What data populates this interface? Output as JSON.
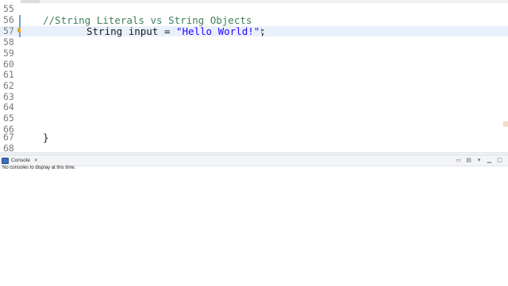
{
  "editor": {
    "lines": [
      {
        "num": "55",
        "code": ""
      },
      {
        "num": "56",
        "code": "//String Literals vs String Objects"
      },
      {
        "num": "57",
        "code_type": "String",
        "code_var": "input",
        "code_eq": "=",
        "code_str": "\"Hello World!\"",
        "code_end": ";"
      },
      {
        "num": "58",
        "code": ""
      },
      {
        "num": "59",
        "code": ""
      },
      {
        "num": "60",
        "code": ""
      },
      {
        "num": "61",
        "code": ""
      },
      {
        "num": "62",
        "code": ""
      },
      {
        "num": "63",
        "code": ""
      },
      {
        "num": "64",
        "code": ""
      },
      {
        "num": "65",
        "code": ""
      },
      {
        "num": "66",
        "code": ""
      },
      {
        "num": "67",
        "code": "}"
      },
      {
        "num": "68",
        "code": ""
      }
    ],
    "cursor_glyph": "I"
  },
  "console": {
    "tab_label": "Console",
    "tab_close": "✕",
    "message": "No consoles to display at this time.",
    "toolbar_icons": [
      "pin-console-icon",
      "display-selected-console-icon",
      "open-console-icon",
      "minimize-icon",
      "maximize-icon"
    ]
  },
  "colors": {
    "comment": "#3f7f5f",
    "string": "#2a00ff",
    "current_line": "#e8f1fb",
    "line_numbers": "#7b7b7b"
  }
}
